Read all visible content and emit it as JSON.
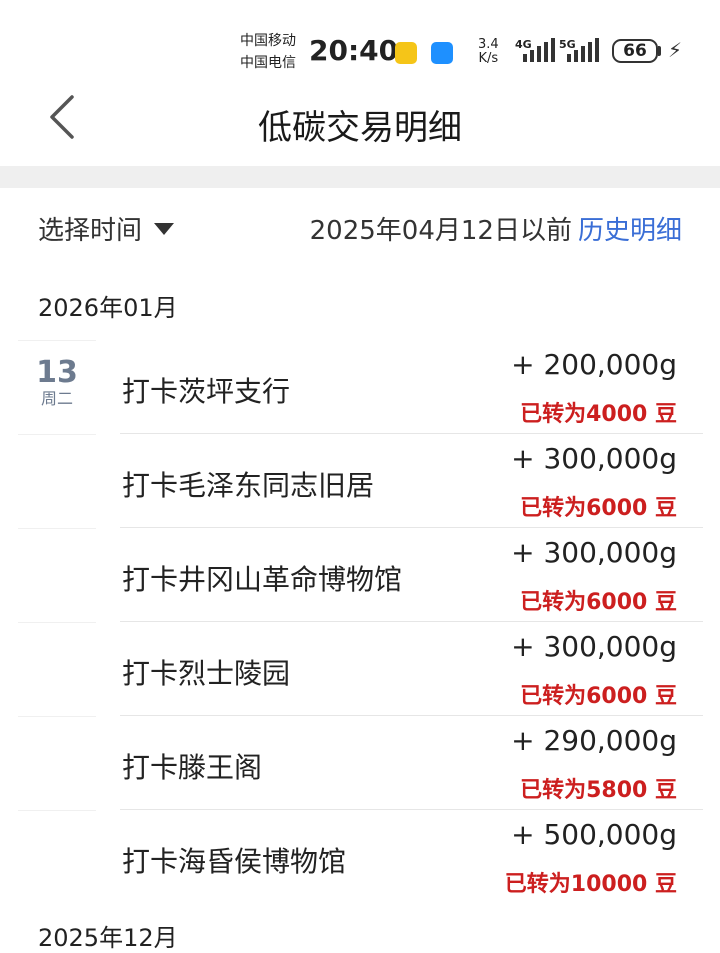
{
  "status_bar": {
    "carrier_1": "中国移动",
    "carrier_2": "中国电信",
    "time": "20:40",
    "net_speed_value": "3.4",
    "net_speed_unit": "K/s",
    "signal_1_label": "4G",
    "signal_2_label": "5G",
    "battery": "66"
  },
  "header": {
    "title": "低碳交易明细",
    "back_icon": "chevron-left-icon"
  },
  "filter": {
    "label": "选择时间",
    "before_text": "2025年04月12日以前",
    "history_link": "历史明细"
  },
  "groups": [
    {
      "month": "2026年01月",
      "day": "13",
      "weekday": "周二",
      "items": [
        {
          "name": "打卡茨坪支行",
          "amount": "+ 200,000g",
          "converted": "已转为4000 豆"
        },
        {
          "name": "打卡毛泽东同志旧居",
          "amount": "+ 300,000g",
          "converted": "已转为6000 豆"
        },
        {
          "name": "打卡井冈山革命博物馆",
          "amount": "+ 300,000g",
          "converted": "已转为6000 豆"
        },
        {
          "name": "打卡烈士陵园",
          "amount": "+ 300,000g",
          "converted": "已转为6000 豆"
        },
        {
          "name": "打卡滕王阁",
          "amount": "+ 290,000g",
          "converted": "已转为5800 豆"
        },
        {
          "name": "打卡海昏侯博物馆",
          "amount": "+ 500,000g",
          "converted": "已转为10000 豆"
        }
      ]
    }
  ],
  "next_month": "2025年12月",
  "colors": {
    "accent_link": "#3a6ed6",
    "converted_red": "#cc1f1f",
    "date_gray": "#6d7b8f"
  }
}
